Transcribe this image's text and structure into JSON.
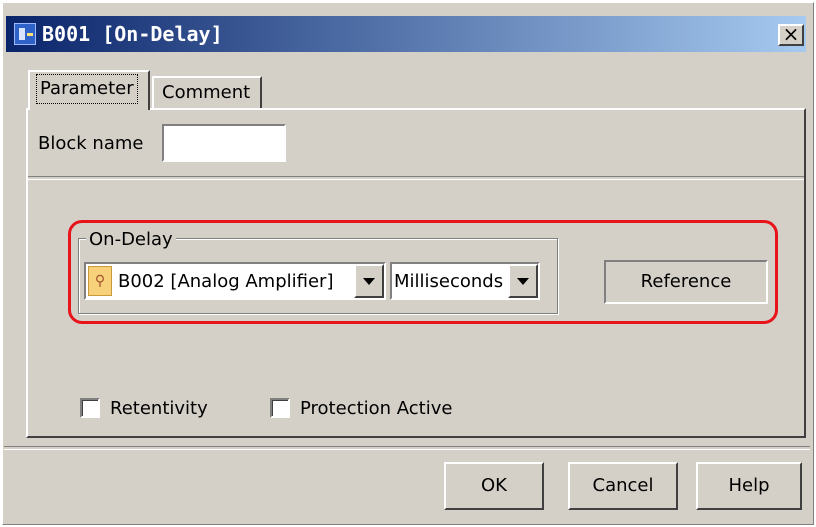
{
  "window": {
    "title": "B001 [On-Delay]",
    "close_glyph": "×"
  },
  "tabs": [
    {
      "label": "Parameter",
      "active": true
    },
    {
      "label": "Comment",
      "active": false
    }
  ],
  "block_name": {
    "label": "Block name",
    "value": ""
  },
  "on_delay": {
    "group_label": "On-Delay",
    "block_select": {
      "value": "B002 [Analog Amplifier]",
      "icon": "analog-amplifier-icon"
    },
    "unit_select": {
      "value": "Milliseconds"
    },
    "reference_label": "Reference"
  },
  "checkboxes": {
    "retentivity": {
      "label": "Retentivity",
      "checked": false
    },
    "protection": {
      "label": "Protection Active",
      "checked": false
    }
  },
  "buttons": {
    "ok": "OK",
    "cancel": "Cancel",
    "help": "Help"
  },
  "colors": {
    "title_bar_start": "#0a246a",
    "title_bar_end": "#a6caf0",
    "highlight": "#e8141c",
    "face": "#d4d0c8"
  }
}
